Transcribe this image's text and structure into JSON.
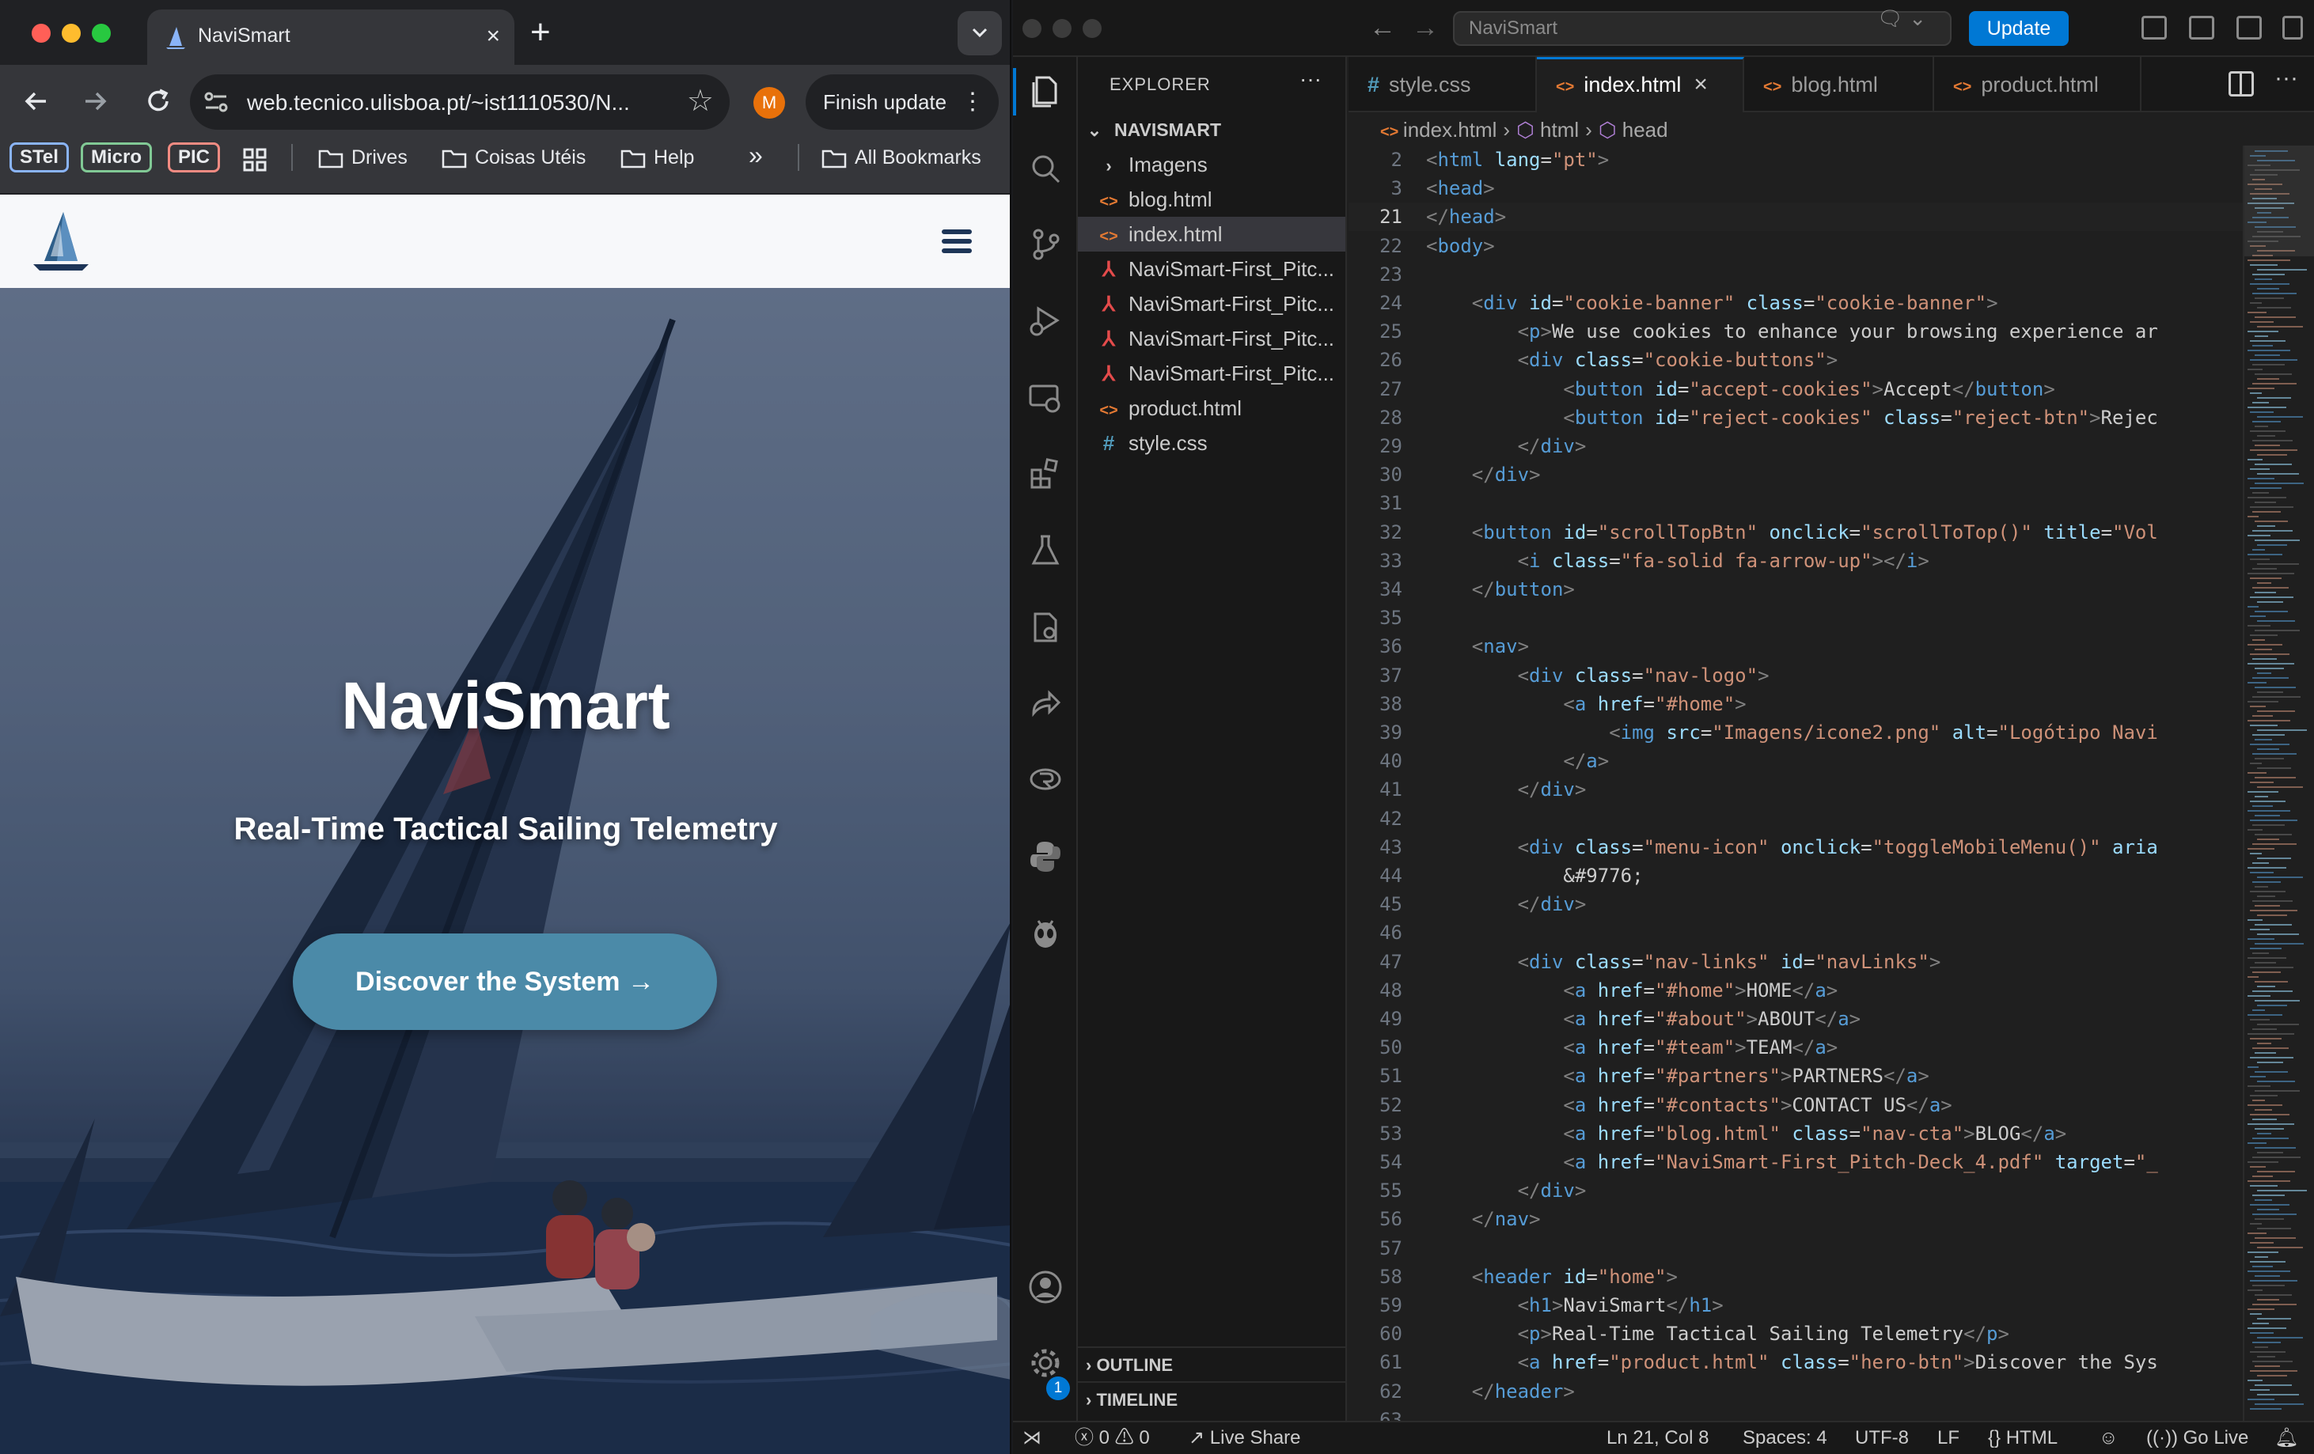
{
  "browser": {
    "tab_title": "NaviSmart",
    "tab_close": "×",
    "new_tab": "+",
    "url": "web.tecnico.ulisboa.pt/~ist1110530/N...",
    "profile_initial": "M",
    "finish_update_label": "Finish update",
    "bookmarks": {
      "chips": [
        {
          "label": "STel",
          "color": "#8ab4f8"
        },
        {
          "label": "Micro",
          "color": "#81c995"
        },
        {
          "label": "PIC",
          "color": "#f28b82"
        }
      ],
      "folders": [
        "Drives",
        "Coisas Utéis",
        "Help"
      ],
      "more": "»",
      "all_bookmarks": "All Bookmarks"
    }
  },
  "website": {
    "hero_title": "NaviSmart",
    "hero_subtitle": "Real-Time Tactical Sailing Telemetry",
    "hero_button": "Discover the System →",
    "colors": {
      "nav_bg": "#f7f8fa",
      "button_bg": "#4b8aa8",
      "menu_icon": "#1d3557"
    }
  },
  "vscode": {
    "command_center": "NaviSmart",
    "update_button": "Update",
    "explorer": {
      "title": "EXPLORER",
      "more": "···",
      "root": "NAVISMART",
      "items": [
        {
          "label": "Imagens",
          "type": "folder"
        },
        {
          "label": "blog.html",
          "type": "html"
        },
        {
          "label": "index.html",
          "type": "html",
          "selected": true
        },
        {
          "label": "NaviSmart-First_Pitc...",
          "type": "pdf"
        },
        {
          "label": "NaviSmart-First_Pitc...",
          "type": "pdf"
        },
        {
          "label": "NaviSmart-First_Pitc...",
          "type": "pdf"
        },
        {
          "label": "NaviSmart-First_Pitc...",
          "type": "pdf"
        },
        {
          "label": "product.html",
          "type": "html"
        },
        {
          "label": "style.css",
          "type": "css"
        }
      ],
      "outline": "OUTLINE",
      "timeline": "TIMELINE"
    },
    "tabs": [
      {
        "label": "style.css",
        "type": "css",
        "active": false
      },
      {
        "label": "index.html",
        "type": "html",
        "active": true
      },
      {
        "label": "blog.html",
        "type": "html",
        "active": false
      },
      {
        "label": "product.html",
        "type": "html",
        "active": false
      }
    ],
    "breadcrumb": [
      "index.html",
      "html",
      "head"
    ],
    "current_line": "21",
    "code_lines": [
      {
        "n": "2",
        "t": "<html lang=\"pt\">"
      },
      {
        "n": "3",
        "t": "<head>"
      },
      {
        "n": "21",
        "t": "</head>"
      },
      {
        "n": "22",
        "t": "<body>"
      },
      {
        "n": "23",
        "t": ""
      },
      {
        "n": "24",
        "t": "    <div id=\"cookie-banner\" class=\"cookie-banner\">"
      },
      {
        "n": "25",
        "t": "        <p>We use cookies to enhance your browsing experience ar"
      },
      {
        "n": "26",
        "t": "        <div class=\"cookie-buttons\">"
      },
      {
        "n": "27",
        "t": "            <button id=\"accept-cookies\">Accept</button>"
      },
      {
        "n": "28",
        "t": "            <button id=\"reject-cookies\" class=\"reject-btn\">Rejec"
      },
      {
        "n": "29",
        "t": "        </div>"
      },
      {
        "n": "30",
        "t": "    </div>"
      },
      {
        "n": "31",
        "t": ""
      },
      {
        "n": "32",
        "t": "    <button id=\"scrollTopBtn\" onclick=\"scrollToTop()\" title=\"Vol"
      },
      {
        "n": "33",
        "t": "        <i class=\"fa-solid fa-arrow-up\"></i>"
      },
      {
        "n": "34",
        "t": "    </button>"
      },
      {
        "n": "35",
        "t": ""
      },
      {
        "n": "36",
        "t": "    <nav>"
      },
      {
        "n": "37",
        "t": "        <div class=\"nav-logo\">"
      },
      {
        "n": "38",
        "t": "            <a href=\"#home\">"
      },
      {
        "n": "39",
        "t": "                <img src=\"Imagens/icone2.png\" alt=\"Logótipo Navi"
      },
      {
        "n": "40",
        "t": "            </a>"
      },
      {
        "n": "41",
        "t": "        </div>"
      },
      {
        "n": "42",
        "t": ""
      },
      {
        "n": "43",
        "t": "        <div class=\"menu-icon\" onclick=\"toggleMobileMenu()\" aria"
      },
      {
        "n": "44",
        "t": "            &#9776;"
      },
      {
        "n": "45",
        "t": "        </div>"
      },
      {
        "n": "46",
        "t": ""
      },
      {
        "n": "47",
        "t": "        <div class=\"nav-links\" id=\"navLinks\">"
      },
      {
        "n": "48",
        "t": "            <a href=\"#home\">HOME</a>"
      },
      {
        "n": "49",
        "t": "            <a href=\"#about\">ABOUT</a>"
      },
      {
        "n": "50",
        "t": "            <a href=\"#team\">TEAM</a>"
      },
      {
        "n": "51",
        "t": "            <a href=\"#partners\">PARTNERS</a>"
      },
      {
        "n": "52",
        "t": "            <a href=\"#contacts\">CONTACT US</a>"
      },
      {
        "n": "53",
        "t": "            <a href=\"blog.html\" class=\"nav-cta\">BLOG</a>"
      },
      {
        "n": "54",
        "t": "            <a href=\"NaviSmart-First_Pitch-Deck_4.pdf\" target=\"_"
      },
      {
        "n": "55",
        "t": "        </div>"
      },
      {
        "n": "56",
        "t": "    </nav>"
      },
      {
        "n": "57",
        "t": ""
      },
      {
        "n": "58",
        "t": "    <header id=\"home\">"
      },
      {
        "n": "59",
        "t": "        <h1>NaviSmart</h1>"
      },
      {
        "n": "60",
        "t": "        <p>Real-Time Tactical Sailing Telemetry</p>"
      },
      {
        "n": "61",
        "t": "        <a href=\"product.html\" class=\"hero-btn\">Discover the Sys"
      },
      {
        "n": "62",
        "t": "    </header>"
      },
      {
        "n": "63",
        "t": ""
      }
    ],
    "status": {
      "errors": "0",
      "warnings": "0",
      "live_share": "Live Share",
      "position": "Ln 21, Col 8",
      "spaces": "Spaces: 4",
      "encoding": "UTF-8",
      "eol": "LF",
      "language": "HTML",
      "go_live": "Go Live"
    },
    "settings_badge": "1"
  }
}
